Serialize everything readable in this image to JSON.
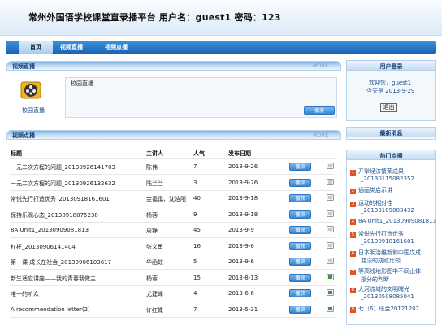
{
  "header": {
    "title": "常州外国语学校课堂直录播平台  用户名：guest1 密码：123"
  },
  "nav": {
    "items": [
      "首页",
      "视频直播",
      "视频点播"
    ]
  },
  "live": {
    "title": "视频直播",
    "more": "MORE",
    "icon_label": "校园直播",
    "channel": "校园直播",
    "button": "播放"
  },
  "vod": {
    "title": "视频点播",
    "more": "MORE",
    "headers": [
      "标题",
      "主讲人",
      "人气",
      "发布日期"
    ],
    "button": "播放",
    "rows": [
      {
        "title": "一元二次方程的问题_20130926141703",
        "speaker": "陈伟",
        "views": "7",
        "date": "2013-9-26"
      },
      {
        "title": "一元二次方程的问题_20130926132632",
        "speaker": "陆兰兰",
        "views": "3",
        "date": "2013-9-26"
      },
      {
        "title": "常悦先行打造优秀_20130918161601",
        "speaker": "金霭霭、沈浩阳",
        "views": "40",
        "date": "2013-9-18"
      },
      {
        "title": "保持乐观心态_20130918075238",
        "speaker": "杨蓉",
        "views": "9",
        "date": "2013-9-18"
      },
      {
        "title": "8A Unit1_20130909081813",
        "speaker": "周铮",
        "views": "45",
        "date": "2013-9-9"
      },
      {
        "title": "杠杆_20130906141404",
        "speaker": "张义勇",
        "views": "16",
        "date": "2013-9-6"
      },
      {
        "title": "第一课  成长在社会_20130906103617",
        "speaker": "华函蛟",
        "views": "5",
        "date": "2013-9-6"
      },
      {
        "title": "新生适应讲座——我的青春我做主",
        "speaker": "杨蓉",
        "views": "15",
        "date": "2013-8-13"
      },
      {
        "title": "唯一的听众",
        "speaker": "尤建峰",
        "views": "4",
        "date": "2013-6-6"
      },
      {
        "title": "A recommendation letter(2)",
        "speaker": "许红姝",
        "views": "7",
        "date": "2013-5-31"
      }
    ]
  },
  "login": {
    "title": "用户登录",
    "welcome": "欢迎您，guest1",
    "today": "今天是  2013-9-29",
    "logout": "退出"
  },
  "news": {
    "title": "最新消息"
  },
  "popular": {
    "title": "热门点播",
    "items": [
      {
        "num": "1",
        "line1": "开掌经济繁荣成果",
        "line2": "_20130115082352"
      },
      {
        "num": "2",
        "line1": "通画类启示讲",
        "line2": ""
      },
      {
        "num": "3",
        "line1": "运动的相对性",
        "line2": "_20130109083432"
      },
      {
        "num": "4",
        "line1": "8A Unit1_20130909081813",
        "line2": ""
      },
      {
        "num": "5",
        "line1": "常悦先行打造优秀",
        "line2": "_20130918161601"
      },
      {
        "num": "6",
        "line1": "日本明治维新和中国戊戌",
        "line2": "变法的成败比较"
      },
      {
        "num": "7",
        "line1": "等高线地形图中不同山体",
        "line2": "部分的判断"
      },
      {
        "num": "8",
        "line1": "大河流域的文明曙光",
        "line2": "_20130508085041"
      },
      {
        "num": "9",
        "line1": "七（6）班会20121207",
        "line2": ""
      }
    ]
  }
}
